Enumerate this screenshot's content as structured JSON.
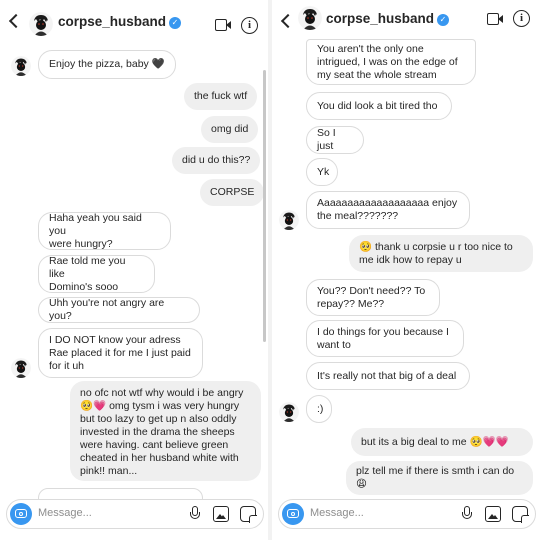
{
  "header": {
    "username": "corpse_husband",
    "verified_icon": "verified-badge-icon"
  },
  "left": {
    "messages": [
      {
        "text": "Enjoy the pizza, baby 🖤"
      },
      {
        "text": "the fuck wtf"
      },
      {
        "text": "omg did"
      },
      {
        "text": "did u do this??"
      },
      {
        "text": "CORPSE"
      },
      {
        "text": "Haha yeah you said you\nwere hungry?"
      },
      {
        "text": "Rae told me you like\nDomino's sooo"
      },
      {
        "text": "Uhh you're not angry are you?"
      },
      {
        "text": "I DO NOT know your adress\nRae placed it for me I just paid\nfor it uh"
      },
      {
        "text": "no ofc not wtf why would i be angry\n🥺💗 omg tysm i was very hungry\nbut too lazy to get up n also oddly\ninvested in the drama the sheeps\nwere having. cant believe green\ncheated in her husband white with\npink!! man..."
      }
    ]
  },
  "right": {
    "messages": [
      {
        "text": "You aren't the only one\nintrigued, I was on the edge of\nmy seat the whole stream"
      },
      {
        "text": "You did look a bit tired tho"
      },
      {
        "text": "So I just"
      },
      {
        "text": "Yk"
      },
      {
        "text": "Aaaaaaaaaaaaaaaaaaa enjoy\nthe meal???????"
      },
      {
        "text": "🥺 thank u corpsie u r too nice to\nme idk how to repay u"
      },
      {
        "text": "You?? Don't need?? To\nrepay?? Me??"
      },
      {
        "text": "I do things for you because I\nwant to"
      },
      {
        "text": "It's really not that big of a deal"
      },
      {
        "text": ":)"
      },
      {
        "text": "but its a big deal to me 🥺💗💗"
      },
      {
        "text": "plz tell me if there is smth i can do\n😩"
      }
    ]
  },
  "composer": {
    "placeholder": "Message..."
  }
}
